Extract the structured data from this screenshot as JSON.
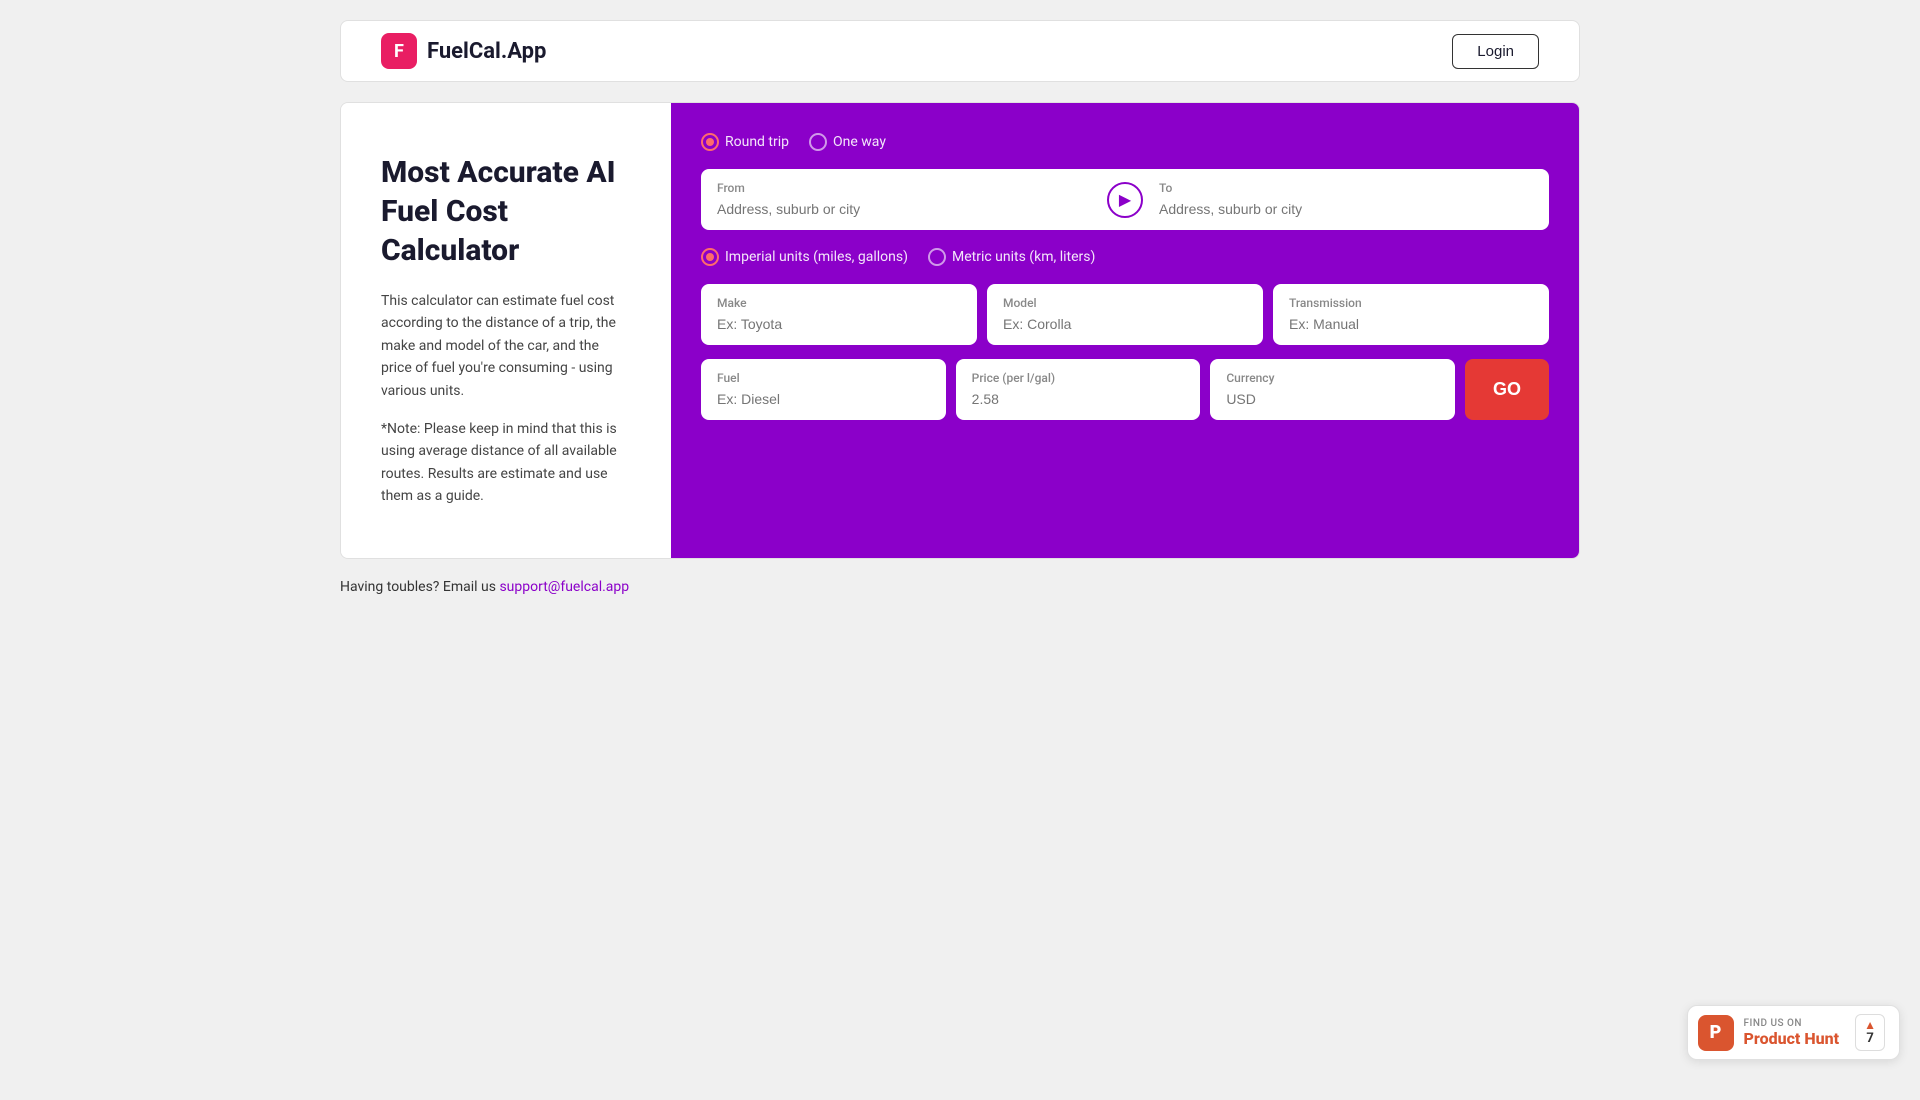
{
  "header": {
    "logo_icon_text": "F",
    "logo_text": "FuelCal.App",
    "login_label": "Login"
  },
  "left_panel": {
    "title_line1": "Most Accurate AI",
    "title_line2": "Fuel Cost Calculator",
    "description": "This calculator can estimate fuel cost according to the distance of a trip, the make and model of the car, and the price of fuel you're consuming - using various units.",
    "note": "*Note: Please keep in mind that this is using average distance of all available routes. Results are estimate and use them as a guide."
  },
  "right_panel": {
    "trip_type": {
      "round_trip_label": "Round trip",
      "one_way_label": "One way",
      "selected": "round_trip"
    },
    "from_placeholder": "Address, suburb or city",
    "from_label": "From",
    "to_placeholder": "Address, suburb or city",
    "to_label": "To",
    "units": {
      "imperial_label": "Imperial units (miles, gallons)",
      "metric_label": "Metric units (km, liters)",
      "selected": "imperial"
    },
    "make_label": "Make",
    "make_placeholder": "Ex: Toyota",
    "model_label": "Model",
    "model_placeholder": "Ex: Corolla",
    "transmission_label": "Transmission",
    "transmission_placeholder": "Ex: Manual",
    "fuel_label": "Fuel",
    "fuel_placeholder": "Ex: Diesel",
    "price_label": "Price (per l/gal)",
    "price_placeholder": "2.58",
    "currency_label": "Currency",
    "currency_placeholder": "USD",
    "go_label": "GO"
  },
  "support": {
    "text": "Having toubles? Email us ",
    "email": "support@fuelcal.app"
  },
  "product_hunt": {
    "icon_letter": "P",
    "find_us_text": "FIND US ON",
    "name": "Product Hunt",
    "upvote_count": "7"
  }
}
